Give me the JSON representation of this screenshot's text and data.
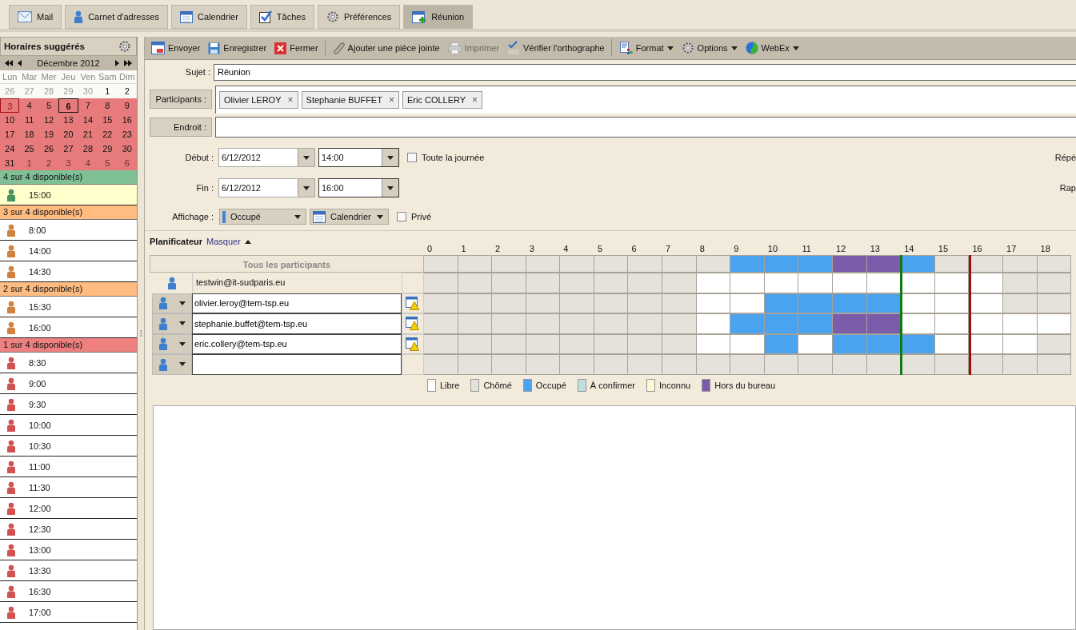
{
  "tabs": [
    {
      "label": "Mail",
      "selected": false
    },
    {
      "label": "Carnet d'adresses",
      "selected": false
    },
    {
      "label": "Calendrier",
      "selected": false
    },
    {
      "label": "Tâches",
      "selected": false
    },
    {
      "label": "Préférences",
      "selected": false
    },
    {
      "label": "Réunion",
      "selected": true
    }
  ],
  "sidebar": {
    "title": "Horaires suggérés",
    "month": "Décembre 2012",
    "weekdays": [
      "Lun",
      "Mar",
      "Mer",
      "Jeu",
      "Ven",
      "Sam",
      "Dim"
    ],
    "days": [
      {
        "label": "26",
        "muted": true,
        "busy": false,
        "today": false,
        "selected": false
      },
      {
        "label": "27",
        "muted": true,
        "busy": false,
        "today": false,
        "selected": false
      },
      {
        "label": "28",
        "muted": true,
        "busy": false,
        "today": false,
        "selected": false
      },
      {
        "label": "29",
        "muted": true,
        "busy": false,
        "today": false,
        "selected": false
      },
      {
        "label": "30",
        "muted": true,
        "busy": false,
        "today": false,
        "selected": false
      },
      {
        "label": "1",
        "muted": false,
        "busy": false,
        "today": false,
        "selected": false
      },
      {
        "label": "2",
        "muted": false,
        "busy": false,
        "today": false,
        "selected": false
      },
      {
        "label": "3",
        "muted": false,
        "busy": true,
        "today": true,
        "selected": false
      },
      {
        "label": "4",
        "muted": false,
        "busy": true,
        "today": false,
        "selected": false
      },
      {
        "label": "5",
        "muted": false,
        "busy": true,
        "today": false,
        "selected": false
      },
      {
        "label": "6",
        "muted": false,
        "busy": true,
        "today": false,
        "selected": true
      },
      {
        "label": "7",
        "muted": false,
        "busy": true,
        "today": false,
        "selected": false
      },
      {
        "label": "8",
        "muted": false,
        "busy": true,
        "today": false,
        "selected": false
      },
      {
        "label": "9",
        "muted": false,
        "busy": true,
        "today": false,
        "selected": false
      },
      {
        "label": "10",
        "muted": false,
        "busy": true,
        "today": false,
        "selected": false
      },
      {
        "label": "11",
        "muted": false,
        "busy": true,
        "today": false,
        "selected": false
      },
      {
        "label": "12",
        "muted": false,
        "busy": true,
        "today": false,
        "selected": false
      },
      {
        "label": "13",
        "muted": false,
        "busy": true,
        "today": false,
        "selected": false
      },
      {
        "label": "14",
        "muted": false,
        "busy": true,
        "today": false,
        "selected": false
      },
      {
        "label": "15",
        "muted": false,
        "busy": true,
        "today": false,
        "selected": false
      },
      {
        "label": "16",
        "muted": false,
        "busy": true,
        "today": false,
        "selected": false
      },
      {
        "label": "17",
        "muted": false,
        "busy": true,
        "today": false,
        "selected": false
      },
      {
        "label": "18",
        "muted": false,
        "busy": true,
        "today": false,
        "selected": false
      },
      {
        "label": "19",
        "muted": false,
        "busy": true,
        "today": false,
        "selected": false
      },
      {
        "label": "20",
        "muted": false,
        "busy": true,
        "today": false,
        "selected": false
      },
      {
        "label": "21",
        "muted": false,
        "busy": true,
        "today": false,
        "selected": false
      },
      {
        "label": "22",
        "muted": false,
        "busy": true,
        "today": false,
        "selected": false
      },
      {
        "label": "23",
        "muted": false,
        "busy": true,
        "today": false,
        "selected": false
      },
      {
        "label": "24",
        "muted": false,
        "busy": true,
        "today": false,
        "selected": false
      },
      {
        "label": "25",
        "muted": false,
        "busy": true,
        "today": false,
        "selected": false
      },
      {
        "label": "26",
        "muted": false,
        "busy": true,
        "today": false,
        "selected": false
      },
      {
        "label": "27",
        "muted": false,
        "busy": true,
        "today": false,
        "selected": false
      },
      {
        "label": "28",
        "muted": false,
        "busy": true,
        "today": false,
        "selected": false
      },
      {
        "label": "29",
        "muted": false,
        "busy": true,
        "today": false,
        "selected": false
      },
      {
        "label": "30",
        "muted": false,
        "busy": true,
        "today": false,
        "selected": false
      },
      {
        "label": "31",
        "muted": false,
        "busy": true,
        "today": false,
        "selected": false
      },
      {
        "label": "1",
        "muted": true,
        "busy": true,
        "today": false,
        "selected": false
      },
      {
        "label": "2",
        "muted": true,
        "busy": true,
        "today": false,
        "selected": false
      },
      {
        "label": "3",
        "muted": true,
        "busy": true,
        "today": false,
        "selected": false
      },
      {
        "label": "4",
        "muted": true,
        "busy": true,
        "today": false,
        "selected": false
      },
      {
        "label": "5",
        "muted": true,
        "busy": true,
        "today": false,
        "selected": false
      },
      {
        "label": "6",
        "muted": true,
        "busy": true,
        "today": false,
        "selected": false
      }
    ],
    "groups": [
      {
        "label": "4 sur 4 disponible(s)",
        "color": "#80c096",
        "times": [
          {
            "label": "15:00",
            "selected": true
          }
        ]
      },
      {
        "label": "3 sur 4 disponible(s)",
        "color": "#ffbb80",
        "times": [
          {
            "label": "8:00",
            "selected": false
          },
          {
            "label": "14:00",
            "selected": false
          },
          {
            "label": "14:30",
            "selected": false
          }
        ]
      },
      {
        "label": "2 sur 4 disponible(s)",
        "color": "#ffbb80",
        "times": [
          {
            "label": "15:30",
            "selected": false
          },
          {
            "label": "16:00",
            "selected": false
          }
        ]
      },
      {
        "label": "1 sur 4 disponible(s)",
        "color": "#ee8080",
        "times": [
          {
            "label": "8:30",
            "selected": false
          },
          {
            "label": "9:00",
            "selected": false
          },
          {
            "label": "9:30",
            "selected": false
          },
          {
            "label": "10:00",
            "selected": false
          },
          {
            "label": "10:30",
            "selected": false
          },
          {
            "label": "11:00",
            "selected": false
          },
          {
            "label": "11:30",
            "selected": false
          },
          {
            "label": "12:00",
            "selected": false
          },
          {
            "label": "12:30",
            "selected": false
          },
          {
            "label": "13:00",
            "selected": false
          },
          {
            "label": "13:30",
            "selected": false
          },
          {
            "label": "16:30",
            "selected": false
          },
          {
            "label": "17:00",
            "selected": false
          }
        ]
      }
    ]
  },
  "toolbar": [
    {
      "label": "Envoyer",
      "disabled": false,
      "dropdown": false,
      "separator_after": false
    },
    {
      "label": "Enregistrer",
      "disabled": false,
      "dropdown": false,
      "separator_after": false
    },
    {
      "label": "Fermer",
      "disabled": false,
      "dropdown": false,
      "separator_after": true
    },
    {
      "label": "Ajouter une pièce jointe",
      "disabled": false,
      "dropdown": false,
      "separator_after": false
    },
    {
      "label": "Imprimer",
      "disabled": true,
      "dropdown": false,
      "separator_after": false
    },
    {
      "label": "Vérifier l'orthographe",
      "disabled": false,
      "dropdown": false,
      "separator_after": true
    },
    {
      "label": "Format",
      "disabled": false,
      "dropdown": true,
      "separator_after": false
    },
    {
      "label": "Options",
      "disabled": false,
      "dropdown": true,
      "separator_after": false
    },
    {
      "label": "WebEx",
      "disabled": false,
      "dropdown": true,
      "separator_after": false
    }
  ],
  "form": {
    "subject_label": "Sujet :",
    "subject": "Réunion",
    "participants_label": "Participants :",
    "participants": [
      "Olivier LEROY",
      "Stephanie BUFFET",
      "Eric COLLERY"
    ],
    "remove_mark": "×",
    "location_label": "Endroit :",
    "start_label": "Début :",
    "start_date": "6/12/2012",
    "start_time": "14:00",
    "all_day": {
      "label": "Toute la journée",
      "checked": false
    },
    "repeat_label": "Répé",
    "end_label": "Fin :",
    "end_date": "6/12/2012",
    "end_time": "16:00",
    "reminder_label": "Rap",
    "show_label": "Affichage :",
    "show_as": "Occupé",
    "calendar": "Calendrier",
    "private": {
      "label": "Privé",
      "checked": false
    }
  },
  "scheduler": {
    "title": "Planificateur",
    "toggle": "Masquer",
    "all_label": "Tous les participants",
    "hours": [
      {
        "label": "0",
        "meeting_start": false,
        "meeting_end": false
      },
      {
        "label": "1",
        "meeting_start": false,
        "meeting_end": false
      },
      {
        "label": "2",
        "meeting_start": false,
        "meeting_end": false
      },
      {
        "label": "3",
        "meeting_start": false,
        "meeting_end": false
      },
      {
        "label": "4",
        "meeting_start": false,
        "meeting_end": false
      },
      {
        "label": "5",
        "meeting_start": false,
        "meeting_end": false
      },
      {
        "label": "6",
        "meeting_start": false,
        "meeting_end": false
      },
      {
        "label": "7",
        "meeting_start": false,
        "meeting_end": false
      },
      {
        "label": "8",
        "meeting_start": false,
        "meeting_end": false
      },
      {
        "label": "9",
        "meeting_start": false,
        "meeting_end": false
      },
      {
        "label": "10",
        "meeting_start": false,
        "meeting_end": false
      },
      {
        "label": "11",
        "meeting_start": false,
        "meeting_end": false
      },
      {
        "label": "12",
        "meeting_start": false,
        "meeting_end": false
      },
      {
        "label": "13",
        "meeting_start": false,
        "meeting_end": false
      },
      {
        "label": "14",
        "meeting_start": true,
        "meeting_end": false
      },
      {
        "label": "15",
        "meeting_start": false,
        "meeting_end": false
      },
      {
        "label": "16",
        "meeting_start": false,
        "meeting_end": true
      },
      {
        "label": "17",
        "meeting_start": false,
        "meeting_end": false
      },
      {
        "label": "18",
        "meeting_start": false,
        "meeting_end": false
      }
    ],
    "summary": [
      {
        "color": "#e4e2da"
      },
      {
        "color": "#e4e2da"
      },
      {
        "color": "#e4e2da"
      },
      {
        "color": "#e4e2da"
      },
      {
        "color": "#e4e2da"
      },
      {
        "color": "#e4e2da"
      },
      {
        "color": "#e4e2da"
      },
      {
        "color": "#e4e2da"
      },
      {
        "color": "#e4e2da"
      },
      {
        "color": "#4aa3ee"
      },
      {
        "color": "#4aa3ee"
      },
      {
        "color": "#4aa3ee"
      },
      {
        "color": "#7a5caa"
      },
      {
        "color": "#7a5caa"
      },
      {
        "color": "#4aa3ee"
      },
      {
        "color": "#e4e2da"
      },
      {
        "color": "#e4e2da"
      },
      {
        "color": "#e4e2da"
      },
      {
        "color": "#e4e2da"
      }
    ],
    "rows": [
      {
        "kind": "organizer",
        "email": "testwin@it-sudparis.eu",
        "cells": [
          {
            "color": "#e4e2da"
          },
          {
            "color": "#e4e2da"
          },
          {
            "color": "#e4e2da"
          },
          {
            "color": "#e4e2da"
          },
          {
            "color": "#e4e2da"
          },
          {
            "color": "#e4e2da"
          },
          {
            "color": "#e4e2da"
          },
          {
            "color": "#e4e2da"
          },
          {
            "color": "#ffffff"
          },
          {
            "color": "#ffffff"
          },
          {
            "color": "#ffffff"
          },
          {
            "color": "#ffffff"
          },
          {
            "color": "#ffffff"
          },
          {
            "color": "#ffffff"
          },
          {
            "color": "#ffffff"
          },
          {
            "color": "#ffffff"
          },
          {
            "color": "#ffffff"
          },
          {
            "color": "#e4e2da"
          },
          {
            "color": "#e4e2da"
          }
        ]
      },
      {
        "kind": "attendee",
        "email": "olivier.leroy@tem-tsp.eu",
        "cells": [
          {
            "color": "#e4e2da"
          },
          {
            "color": "#e4e2da"
          },
          {
            "color": "#e4e2da"
          },
          {
            "color": "#e4e2da"
          },
          {
            "color": "#e4e2da"
          },
          {
            "color": "#e4e2da"
          },
          {
            "color": "#e4e2da"
          },
          {
            "color": "#e4e2da"
          },
          {
            "color": "#ffffff"
          },
          {
            "color": "#ffffff"
          },
          {
            "color": "#4aa3ee"
          },
          {
            "color": "#4aa3ee"
          },
          {
            "color": "#4aa3ee"
          },
          {
            "color": "#4aa3ee"
          },
          {
            "color": "#ffffff"
          },
          {
            "color": "#ffffff"
          },
          {
            "color": "#ffffff"
          },
          {
            "color": "#e4e2da"
          },
          {
            "color": "#e4e2da"
          }
        ]
      },
      {
        "kind": "attendee",
        "email": "stephanie.buffet@tem-tsp.eu",
        "cells": [
          {
            "color": "#e4e2da"
          },
          {
            "color": "#e4e2da"
          },
          {
            "color": "#e4e2da"
          },
          {
            "color": "#e4e2da"
          },
          {
            "color": "#e4e2da"
          },
          {
            "color": "#e4e2da"
          },
          {
            "color": "#e4e2da"
          },
          {
            "color": "#e4e2da"
          },
          {
            "color": "#ffffff"
          },
          {
            "color": "#4aa3ee"
          },
          {
            "color": "#4aa3ee"
          },
          {
            "color": "#4aa3ee"
          },
          {
            "color": "#7a5caa"
          },
          {
            "color": "#7a5caa"
          },
          {
            "color": "#ffffff"
          },
          {
            "color": "#ffffff"
          },
          {
            "color": "#ffffff"
          },
          {
            "color": "#ffffff"
          },
          {
            "color": "#ffffff"
          }
        ]
      },
      {
        "kind": "attendee",
        "email": "eric.collery@tem-tsp.eu",
        "cells": [
          {
            "color": "#e4e2da"
          },
          {
            "color": "#e4e2da"
          },
          {
            "color": "#e4e2da"
          },
          {
            "color": "#e4e2da"
          },
          {
            "color": "#e4e2da"
          },
          {
            "color": "#e4e2da"
          },
          {
            "color": "#e4e2da"
          },
          {
            "color": "#e4e2da"
          },
          {
            "color": "#ffffff"
          },
          {
            "color": "#ffffff"
          },
          {
            "color": "#4aa3ee"
          },
          {
            "color": "#ffffff"
          },
          {
            "color": "#4aa3ee"
          },
          {
            "color": "#4aa3ee"
          },
          {
            "color": "#4aa3ee"
          },
          {
            "color": "#ffffff"
          },
          {
            "color": "#ffffff"
          },
          {
            "color": "#ffffff"
          },
          {
            "color": "#e4e2da"
          }
        ]
      },
      {
        "kind": "empty",
        "cells": [
          {
            "color": "#e4e2da"
          },
          {
            "color": "#e4e2da"
          },
          {
            "color": "#e4e2da"
          },
          {
            "color": "#e4e2da"
          },
          {
            "color": "#e4e2da"
          },
          {
            "color": "#e4e2da"
          },
          {
            "color": "#e4e2da"
          },
          {
            "color": "#e4e2da"
          },
          {
            "color": "#e4e2da"
          },
          {
            "color": "#e4e2da"
          },
          {
            "color": "#e4e2da"
          },
          {
            "color": "#e4e2da"
          },
          {
            "color": "#e4e2da"
          },
          {
            "color": "#e4e2da"
          },
          {
            "color": "#e4e2da"
          },
          {
            "color": "#e4e2da"
          },
          {
            "color": "#e4e2da"
          },
          {
            "color": "#e4e2da"
          },
          {
            "color": "#e4e2da"
          }
        ]
      }
    ],
    "legend": [
      {
        "color": "#ffffff",
        "label": "Libre"
      },
      {
        "color": "#e4e2da",
        "label": "Chômé"
      },
      {
        "color": "#4aa3ee",
        "label": "Occupé"
      },
      {
        "color": "#bfe0e0",
        "label": "À confirmer"
      },
      {
        "color": "#fff6d4",
        "label": "Inconnu"
      },
      {
        "color": "#7a5caa",
        "label": "Hors du bureau"
      }
    ]
  }
}
